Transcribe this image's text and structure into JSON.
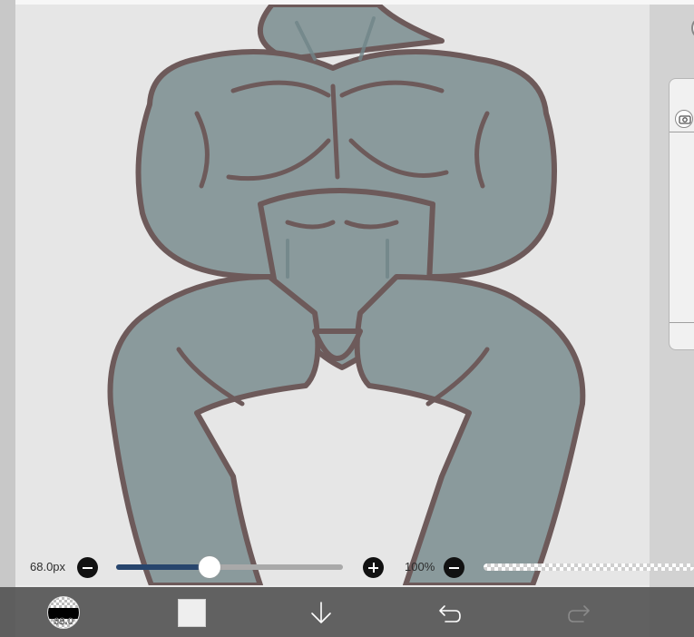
{
  "brush": {
    "size_label": "68.0px",
    "size_value": 68.0,
    "size_fraction": 0.41,
    "preview_value": "68.0",
    "opacity_label": "100%",
    "opacity_value": 100
  },
  "colors": {
    "slider_fill": "#27456d",
    "toolbar_bg": "#555555",
    "figure_fill": "#8a9a9c",
    "figure_outline": "#6d5a5a",
    "current_color": "#eeeeee"
  },
  "icons": {
    "size_decrease": "minus-icon",
    "size_increase": "plus-icon",
    "opacity_decrease": "minus-icon",
    "download": "arrow-down-icon",
    "undo": "undo-icon",
    "redo": "redo-icon",
    "camera": "camera-icon"
  }
}
